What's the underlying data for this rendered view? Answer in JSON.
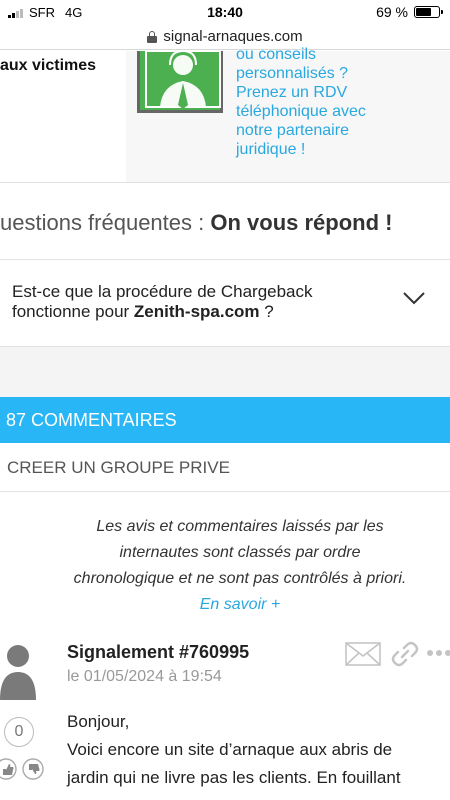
{
  "status_bar": {
    "carrier": "SFR",
    "network": "4G",
    "time": "18:40",
    "battery": "69 %",
    "battery_level": 0.69
  },
  "browser": {
    "url": "signal-arnaques.com"
  },
  "promo": {
    "left_title": "aux victimes",
    "right_text_lines": [
      "ou conseils",
      "personnalisés ?",
      "Prenez un RDV",
      "téléphonique avec",
      "notre partenaire",
      "juridique !"
    ],
    "icon": "support-agent-icon",
    "accent_color": "#29a8e0",
    "icon_bg_color": "#4caf50"
  },
  "faq": {
    "title_prefix": "uestions fréquentes : ",
    "title_bold": "On vous répond !",
    "question_prefix": "Est-ce que la procédure de Chargeback fonctionne pour ",
    "question_site": "Zenith-spa.com",
    "question_suffix": " ?"
  },
  "comments": {
    "header": "87 COMMENTAIRES",
    "header_color": "#29b6f6",
    "group_label": "CREER UN GROUPE PRIVE",
    "disclaimer_lines": [
      "Les avis et commentaires laissés par les",
      "internautes sont classés par ordre",
      "chronologique et ne sont pas contrôlés à priori."
    ],
    "disclaimer_link": "En savoir +",
    "items": [
      {
        "title": "Signalement #760995",
        "date": "le 01/05/2024 à 19:54",
        "score": "0",
        "body_lines": [
          "Bonjour,",
          "Voici encore un site d’arnaque aux abris de",
          "jardin qui ne livre pas les clients. En fouillant"
        ]
      }
    ]
  }
}
